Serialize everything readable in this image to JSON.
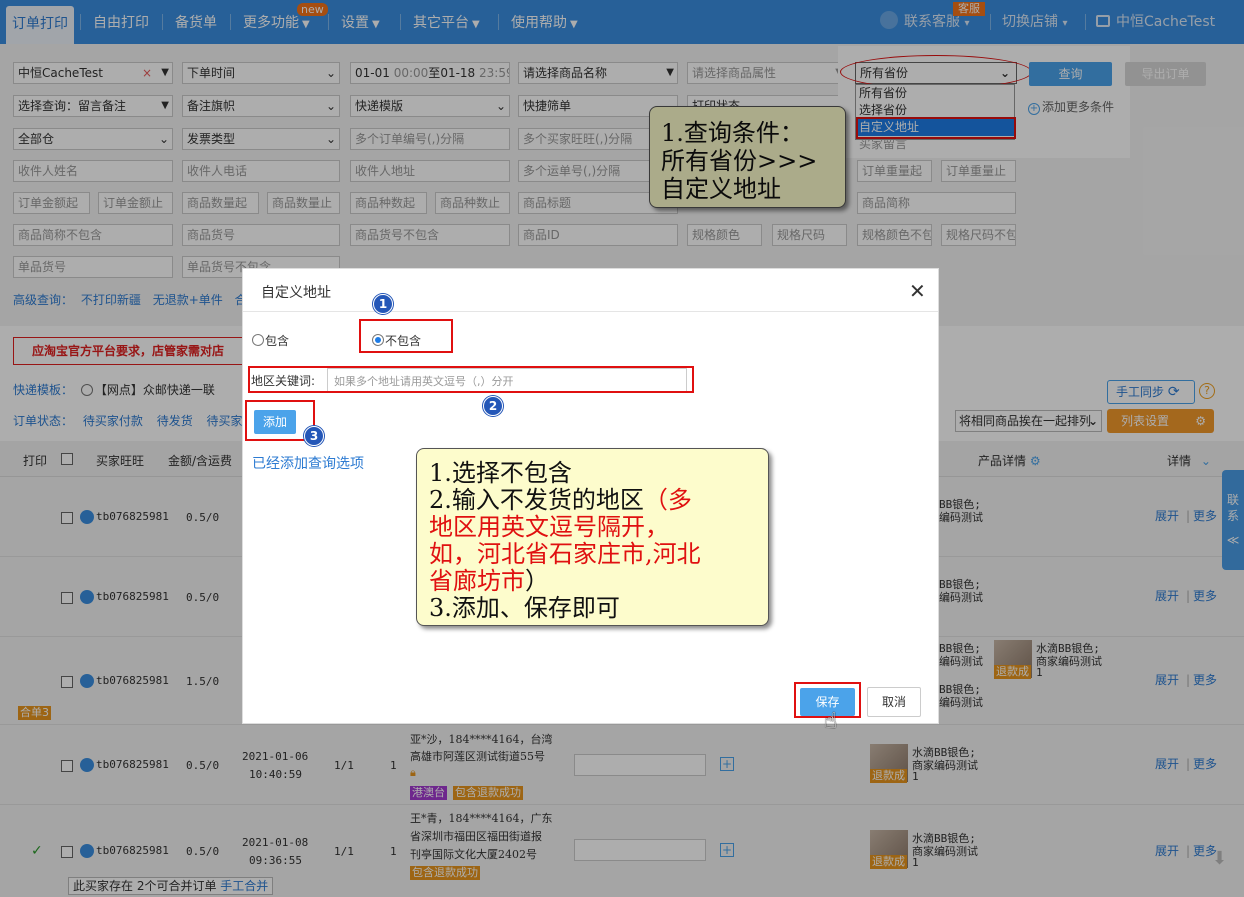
{
  "nav": {
    "tabs": [
      {
        "label": "订单打印",
        "active": true
      },
      {
        "label": "自由打印"
      },
      {
        "label": "备货单"
      },
      {
        "label": "更多功能",
        "badge": "new"
      },
      {
        "label": "设置"
      },
      {
        "label": "其它平台"
      },
      {
        "label": "使用帮助"
      }
    ],
    "service": "联系客服",
    "service_badge": "客服",
    "switch_store": "切换店铺",
    "store_name": "中恒CacheTest"
  },
  "filters": {
    "store": "中恒CacheTest",
    "time_type": "下单时间",
    "date_from": "01-01",
    "time_from": "00:00",
    "to": "至",
    "date_to": "01-18",
    "time_to": "23:59",
    "product_name": "请选择商品名称",
    "product_attr": "请选择商品属性",
    "province": "所有省份",
    "province_options": [
      "所有省份",
      "选择省份",
      "自定义地址"
    ],
    "province_hidden": "买家留言",
    "query": "查询",
    "export": "导出订单",
    "add_condition": "添加更多条件",
    "memo": "选择查询：留言备注",
    "memo_flag": "备注旗帜",
    "express_tpl": "快递模版",
    "quick_filter": "快捷筛单",
    "print_status": "打印状态",
    "warehouse": "全部仓",
    "invoice": "发票类型",
    "order_nos": "多个订单编号(,)分隔",
    "buyer_ids": "多个买家旺旺(,)分隔",
    "receiver_name": "收件人姓名",
    "receiver_phone": "收件人电话",
    "receiver_addr": "收件人地址",
    "waybill_nos": "多个运单号(,)分隔",
    "weight_from": "订单重量起",
    "weight_to": "订单重量止",
    "amount_from": "订单金额起",
    "amount_to": "订单金额止",
    "qty_from": "商品数量起",
    "qty_to": "商品数量止",
    "kinds_from": "商品种数起",
    "kinds_to": "商品种数止",
    "product_title": "商品标题",
    "product_short": "商品简称",
    "short_exclude": "商品简称不包含",
    "product_code": "商品货号",
    "code_exclude": "商品货号不包含",
    "product_id": "商品ID",
    "spec_color": "规格颜色",
    "spec_size": "规格尺码",
    "color_exclude": "规格颜色不包",
    "size_exclude": "规格尺码不包",
    "sku_code": "单品货号",
    "sku_exclude": "单品货号不包含",
    "advanced": "高级查询：",
    "adv_links": [
      "不打印新疆",
      "无退款+单件",
      "合"
    ]
  },
  "notice": "应淘宝官方平台要求，店管家需对店",
  "express_row": {
    "label": "快递模板：",
    "option": "【网点】众邮快递一联"
  },
  "status_row": {
    "label": "订单状态：",
    "items": [
      "待买家付款",
      "待发货",
      "待买家"
    ]
  },
  "right_tools": {
    "sync": "手工同步",
    "merge_same": "将相同商品挨在一起排列",
    "columns": "列表设置"
  },
  "table_header": {
    "print": "打印",
    "buyer": "买家旺旺",
    "amount": "金额/含运费",
    "product": "产品详情",
    "detail": "详情"
  },
  "rows": [
    {
      "buyer": "tb076825981",
      "amount": "0.5/0",
      "expand": "展开",
      "more": "更多",
      "spec": "BB银色;",
      "code": "编码测试"
    },
    {
      "buyer": "tb076825981",
      "amount": "0.5/0",
      "expand": "展开",
      "more": "更多",
      "spec": "BB银色;",
      "code": "编码测试"
    },
    {
      "buyer": "tb076825981",
      "amount": "1.5/0",
      "expand": "展开",
      "more": "更多",
      "merge": "合单3",
      "spec": "BB银色;",
      "code": "编码测试",
      "spec2": "BB银色;",
      "code2": "编码测试",
      "p_name": "水滴BB银色;",
      "p_code": "商家编码测试",
      "refund": "退款成",
      "qty": "1"
    },
    {
      "buyer": "tb076825981",
      "amount": "0.5/0",
      "date": "2021-01-06",
      "time": "10:40:59",
      "ratio": "1/1",
      "count": "1",
      "addr1": "亚*沙，184****4164，台湾",
      "addr2": "高雄市阿莲区测试街道55号",
      "tag1": "港澳台",
      "tag2": "包含退款成功",
      "p_name": "水滴BB银色;",
      "p_code": "商家编码测试",
      "refund": "退款成",
      "qty": "1",
      "expand": "展开",
      "more": "更多"
    },
    {
      "buyer": "tb076825981",
      "amount": "0.5/0",
      "date": "2021-01-08",
      "time": "09:36:55",
      "ratio": "1/1",
      "count": "1",
      "addr1": "王*青，184****4164，广东",
      "addr2": "省深圳市福田区福田街道报",
      "addr3": "刊亭国际文化大厦2402号",
      "tag2": "包含退款成功",
      "p_name": "水滴BB银色;",
      "p_code": "商家编码测试",
      "refund": "退款成",
      "qty": "1",
      "expand": "展开",
      "more": "更多",
      "checked": "✓"
    }
  ],
  "merge_hint": {
    "text": "此买家存在 2个可合并订单",
    "link": "手工合并"
  },
  "side_tab": {
    "chars": [
      "联",
      "系",
      "≪"
    ]
  },
  "modal": {
    "title": "自定义地址",
    "close": "✕",
    "include": "包含",
    "exclude": "不包含",
    "keyword_label": "地区关键词:",
    "keyword_placeholder": "如果多个地址请用英文逗号（,）分开",
    "add": "添加",
    "added_link": "已经添加查询选项",
    "save": "保存",
    "cancel": "取消"
  },
  "steps": [
    "1",
    "2",
    "3"
  ],
  "callout_top": {
    "lines": [
      "1.查询条件：",
      "所有省份>>>",
      "自定义地址"
    ]
  },
  "callout_main": {
    "line1": "1.选择不包含",
    "line2a": "2.输入不发货的地区",
    "line2b": "（多",
    "line3": "地区用英文逗号隔开，",
    "line4": "如，河北省石家庄市,河北",
    "line5": "省廊坊市",
    "line5b": "）",
    "line6": "3.添加、保存即可"
  }
}
